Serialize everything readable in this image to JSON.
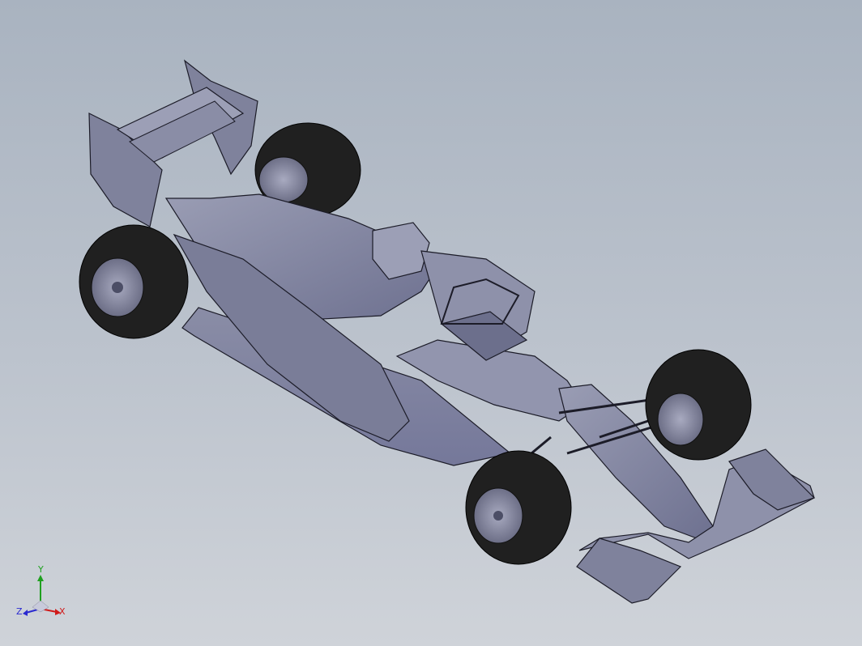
{
  "viewport": {
    "background_top": "#a9b3c0",
    "background_bottom": "#cfd3d9",
    "model_color": "#8d90a8",
    "model_dark": "#5d6078",
    "tire_color": "#202020",
    "edge_color": "#1c1c28"
  },
  "triad": {
    "x_label": "X",
    "y_label": "Y",
    "z_label": "Z",
    "x_color": "#d01a1a",
    "y_color": "#1fa01f",
    "z_color": "#2a2ad0"
  }
}
